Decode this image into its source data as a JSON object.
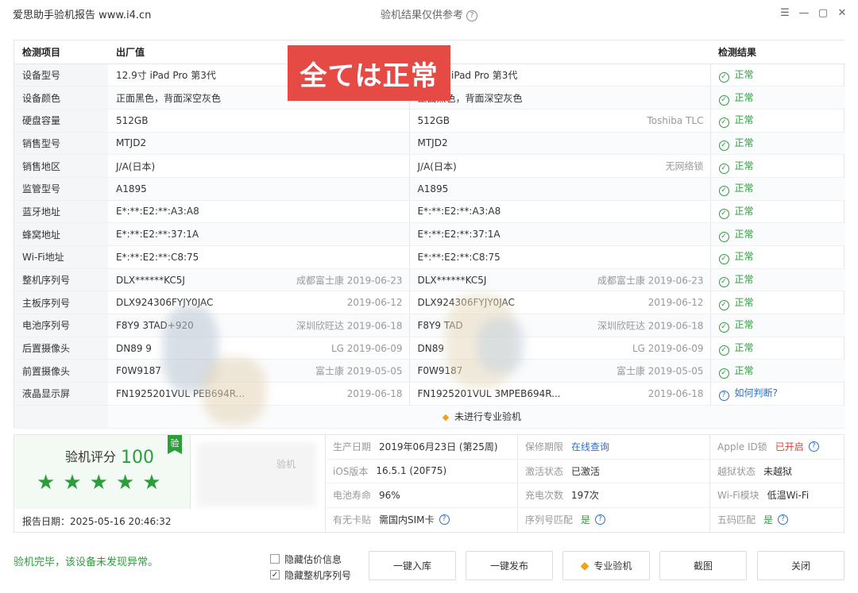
{
  "window": {
    "app_title": "爱思助手验机报告 www.i4.cn",
    "center_title": "验机结果仅供参考",
    "center_help": "?",
    "controls": [
      "☰",
      "—",
      "▢",
      "✕"
    ]
  },
  "overlay_banner": "全ては正常",
  "table": {
    "headers": [
      "检测项目",
      "出厂值",
      "",
      "检测结果"
    ],
    "rows": [
      {
        "item": "设备型号",
        "factory": "12.9寸 iPad Pro 第3代",
        "factory_note": "",
        "actual": "12.9寸 iPad Pro 第3代",
        "actual_note": "",
        "result": "正常"
      },
      {
        "item": "设备颜色",
        "factory": "正面黑色，背面深空灰色",
        "factory_note": "",
        "actual": "正面黑色，背面深空灰色",
        "actual_note": "",
        "result": "正常"
      },
      {
        "item": "硬盘容量",
        "factory": "512GB",
        "factory_note": "",
        "actual": "512GB",
        "actual_note": "Toshiba TLC",
        "result": "正常"
      },
      {
        "item": "销售型号",
        "factory": "MTJD2",
        "factory_note": "",
        "actual": "MTJD2",
        "actual_note": "",
        "result": "正常"
      },
      {
        "item": "销售地区",
        "factory": "J/A(日本)",
        "factory_note": "",
        "actual": "J/A(日本)",
        "actual_note": "无网络锁",
        "result": "正常"
      },
      {
        "item": "监管型号",
        "factory": "A1895",
        "factory_note": "",
        "actual": "A1895",
        "actual_note": "",
        "result": "正常"
      },
      {
        "item": "蓝牙地址",
        "factory": "E*:**:E2:**:A3:A8",
        "factory_note": "",
        "actual": "E*:**:E2:**:A3:A8",
        "actual_note": "",
        "result": "正常"
      },
      {
        "item": "蜂窝地址",
        "factory": "E*:**:E2:**:37:1A",
        "factory_note": "",
        "actual": "E*:**:E2:**:37:1A",
        "actual_note": "",
        "result": "正常"
      },
      {
        "item": "Wi-Fi地址",
        "factory": "E*:**:E2:**:C8:75",
        "factory_note": "",
        "actual": "E*:**:E2:**:C8:75",
        "actual_note": "",
        "result": "正常"
      },
      {
        "item": "整机序列号",
        "factory": "DLX******KC5J",
        "factory_note": "成都富士康 2019-06-23",
        "actual": "DLX******KC5J",
        "actual_note": "成都富士康 2019-06-23",
        "result": "正常"
      },
      {
        "item": "主板序列号",
        "factory": "DLX924306FYJY0JAC",
        "factory_note": "2019-06-12",
        "actual": "DLX924306FYJY0JAC",
        "actual_note": "2019-06-12",
        "result": "正常"
      },
      {
        "item": "电池序列号",
        "factory": "F8Y9     3TAD+920",
        "factory_note": "深圳欣旺达 2019-06-18",
        "actual": "F8Y9      TAD",
        "actual_note": "深圳欣旺达 2019-06-18",
        "result": "正常"
      },
      {
        "item": "后置摄像头",
        "factory": "DN89       9",
        "factory_note": "LG 2019-06-09",
        "actual": "DN89",
        "actual_note": "LG 2019-06-09",
        "result": "正常"
      },
      {
        "item": "前置摄像头",
        "factory": "F0W9187",
        "factory_note": "富士康 2019-05-05",
        "actual": "F0W9187",
        "actual_note": "富士康 2019-05-05",
        "result": "正常"
      },
      {
        "item": "液晶显示屏",
        "factory": "FN1925201VUL    PEB694R...",
        "factory_note": "2019-06-18",
        "actual": "FN1925201VUL   3MPEB694R...",
        "actual_note": "2019-06-18",
        "result": "如何判断?"
      }
    ],
    "footer": "未进行专业验机"
  },
  "summary": {
    "score_label": "验机评分",
    "score": "100",
    "stars": 5,
    "badge": "验",
    "report_date": "报告日期：2025-05-16 20:46:32",
    "blur_text": "验机",
    "info": [
      {
        "k": "生产日期",
        "v": "2019年06月23日 (第25周)",
        "style": "",
        "help": false
      },
      {
        "k": "保修期限",
        "v": "在线查询",
        "style": "link",
        "help": false
      },
      {
        "k": "Apple ID锁",
        "v": "已开启",
        "style": "red",
        "help": true
      },
      {
        "k": "iOS版本",
        "v": "16.5.1 (20F75)",
        "style": "",
        "help": false
      },
      {
        "k": "激活状态",
        "v": "已激活",
        "style": "",
        "help": false
      },
      {
        "k": "越狱状态",
        "v": "未越狱",
        "style": "",
        "help": false
      },
      {
        "k": "电池寿命",
        "v": "96%",
        "style": "",
        "help": false
      },
      {
        "k": "充电次数",
        "v": "197次",
        "style": "",
        "help": false
      },
      {
        "k": "Wi-Fi模块",
        "v": "低温Wi-Fi",
        "style": "",
        "help": false
      },
      {
        "k": "有无卡贴",
        "v": "需国内SIM卡",
        "style": "",
        "help": true
      },
      {
        "k": "序列号匹配",
        "v": "是",
        "style": "green",
        "help": true
      },
      {
        "k": "五码匹配",
        "v": "是",
        "style": "green",
        "help": true
      }
    ]
  },
  "bottom": {
    "status": "验机完毕，该设备未发现异常。",
    "checkbox1": "隐藏估价信息",
    "checkbox2": "隐藏整机序列号",
    "btn_import": "一键入库",
    "btn_publish": "一键发布",
    "btn_pro": "专业验机",
    "btn_screenshot": "截图",
    "btn_close": "关闭"
  }
}
